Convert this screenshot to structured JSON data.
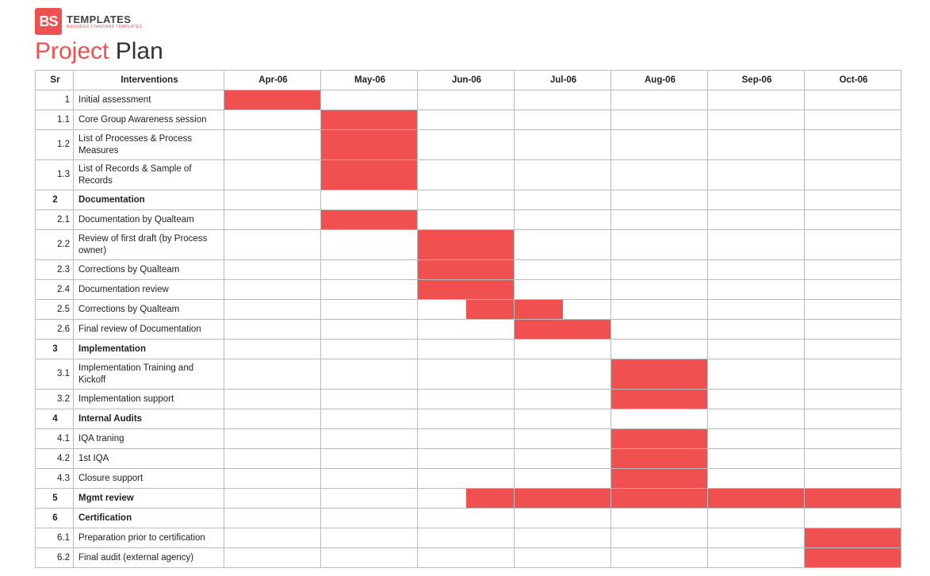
{
  "brand": {
    "logo_text": "BS",
    "label": "TEMPLATES",
    "sublabel": "BUSINESS STANDARD TEMPLATES"
  },
  "title": {
    "accent": "Project",
    "rest": " Plan"
  },
  "headers": {
    "sr": "Sr",
    "desc": "Interventions",
    "months": [
      "Apr-06",
      "May-06",
      "Jun-06",
      "Jul-06",
      "Aug-06",
      "Sep-06",
      "Oct-06"
    ]
  },
  "rows": [
    {
      "sr": "1",
      "desc": "Initial assessment",
      "tall": false,
      "sec": false,
      "bars": [
        "full",
        "",
        "",
        "",
        "",
        "",
        ""
      ]
    },
    {
      "sr": "1.1",
      "desc": "Core Group Awareness session",
      "tall": false,
      "sec": false,
      "bars": [
        "",
        "full",
        "",
        "",
        "",
        "",
        ""
      ]
    },
    {
      "sr": "1.2",
      "desc": "List of Processes & Process Measures",
      "tall": true,
      "sec": false,
      "bars": [
        "",
        "full",
        "",
        "",
        "",
        "",
        ""
      ]
    },
    {
      "sr": "1.3",
      "desc": "List of Records & Sample of Records",
      "tall": true,
      "sec": false,
      "bars": [
        "",
        "full",
        "",
        "",
        "",
        "",
        ""
      ]
    },
    {
      "sr": "2",
      "desc": "Documentation",
      "tall": false,
      "sec": true,
      "bars": [
        "",
        "",
        "",
        "",
        "",
        "",
        ""
      ]
    },
    {
      "sr": "2.1",
      "desc": "Documentation by Qualteam",
      "tall": false,
      "sec": false,
      "bars": [
        "",
        "full",
        "",
        "",
        "",
        "",
        ""
      ]
    },
    {
      "sr": "2.2",
      "desc": "Review of first draft (by Process owner)",
      "tall": true,
      "sec": false,
      "bars": [
        "",
        "",
        "full",
        "",
        "",
        "",
        ""
      ]
    },
    {
      "sr": "2.3",
      "desc": "Corrections by Qualteam",
      "tall": false,
      "sec": false,
      "bars": [
        "",
        "",
        "full",
        "",
        "",
        "",
        ""
      ]
    },
    {
      "sr": "2.4",
      "desc": "Documentation review",
      "tall": false,
      "sec": false,
      "bars": [
        "",
        "",
        "full",
        "",
        "",
        "",
        ""
      ]
    },
    {
      "sr": "2.5",
      "desc": "Corrections by Qualteam",
      "tall": false,
      "sec": false,
      "bars": [
        "",
        "",
        "right",
        "left",
        "",
        "",
        ""
      ]
    },
    {
      "sr": "2.6",
      "desc": "Final review of Documentation",
      "tall": false,
      "sec": false,
      "bars": [
        "",
        "",
        "",
        "full",
        "",
        "",
        ""
      ]
    },
    {
      "sr": "3",
      "desc": "Implementation",
      "tall": false,
      "sec": true,
      "bars": [
        "",
        "",
        "",
        "",
        "",
        "",
        ""
      ]
    },
    {
      "sr": "3.1",
      "desc": "Implementation Training and Kickoff",
      "tall": true,
      "sec": false,
      "bars": [
        "",
        "",
        "",
        "",
        "full",
        "",
        ""
      ]
    },
    {
      "sr": "3.2",
      "desc": "Implementation support",
      "tall": false,
      "sec": false,
      "bars": [
        "",
        "",
        "",
        "",
        "full",
        "",
        ""
      ]
    },
    {
      "sr": "4",
      "desc": "Internal Audits",
      "tall": false,
      "sec": true,
      "bars": [
        "",
        "",
        "",
        "",
        "",
        "",
        ""
      ]
    },
    {
      "sr": "4.1",
      "desc": "IQA traning",
      "tall": false,
      "sec": false,
      "bars": [
        "",
        "",
        "",
        "",
        "full",
        "",
        ""
      ]
    },
    {
      "sr": "4.2",
      "desc": "1st IQA",
      "tall": false,
      "sec": false,
      "bars": [
        "",
        "",
        "",
        "",
        "full",
        "",
        ""
      ]
    },
    {
      "sr": "4.3",
      "desc": "Closure support",
      "tall": false,
      "sec": false,
      "bars": [
        "",
        "",
        "",
        "",
        "full",
        "",
        ""
      ]
    },
    {
      "sr": "5",
      "desc": "Mgmt review",
      "tall": false,
      "sec": true,
      "bars": [
        "",
        "",
        "right",
        "full",
        "full",
        "full",
        "full"
      ]
    },
    {
      "sr": "6",
      "desc": "Certification",
      "tall": false,
      "sec": true,
      "bars": [
        "",
        "",
        "",
        "",
        "",
        "",
        ""
      ]
    },
    {
      "sr": "6.1",
      "desc": "Preparation prior to certification",
      "tall": false,
      "sec": false,
      "bars": [
        "",
        "",
        "",
        "",
        "",
        "",
        "full"
      ]
    },
    {
      "sr": "6.2",
      "desc": "Final audit (external agency)",
      "tall": false,
      "sec": false,
      "bars": [
        "",
        "",
        "",
        "",
        "",
        "",
        "full"
      ]
    }
  ],
  "chart_data": {
    "type": "bar",
    "title": "Project Plan",
    "categories": [
      "Apr-06",
      "May-06",
      "Jun-06",
      "Jul-06",
      "Aug-06",
      "Sep-06",
      "Oct-06"
    ],
    "series": [
      {
        "name": "Initial assessment",
        "start": "Apr-06",
        "end": "Apr-06"
      },
      {
        "name": "Core Group Awareness session",
        "start": "May-06",
        "end": "May-06"
      },
      {
        "name": "List of Processes & Process Measures",
        "start": "May-06",
        "end": "May-06"
      },
      {
        "name": "List of Records & Sample of Records",
        "start": "May-06",
        "end": "May-06"
      },
      {
        "name": "Documentation by Qualteam",
        "start": "May-06",
        "end": "May-06"
      },
      {
        "name": "Review of first draft (by Process owner)",
        "start": "Jun-06",
        "end": "Jun-06"
      },
      {
        "name": "Corrections by Qualteam",
        "start": "Jun-06",
        "end": "Jun-06"
      },
      {
        "name": "Documentation review",
        "start": "Jun-06",
        "end": "Jun-06"
      },
      {
        "name": "Corrections by Qualteam",
        "start": "mid Jun-06",
        "end": "mid Jul-06"
      },
      {
        "name": "Final review of Documentation",
        "start": "Jul-06",
        "end": "Jul-06"
      },
      {
        "name": "Implementation Training and Kickoff",
        "start": "Aug-06",
        "end": "Aug-06"
      },
      {
        "name": "Implementation support",
        "start": "Aug-06",
        "end": "Aug-06"
      },
      {
        "name": "IQA traning",
        "start": "Aug-06",
        "end": "Aug-06"
      },
      {
        "name": "1st IQA",
        "start": "Aug-06",
        "end": "Aug-06"
      },
      {
        "name": "Closure support",
        "start": "Aug-06",
        "end": "Aug-06"
      },
      {
        "name": "Mgmt review",
        "start": "mid Jun-06",
        "end": "Oct-06"
      },
      {
        "name": "Preparation prior to certification",
        "start": "Oct-06",
        "end": "Oct-06"
      },
      {
        "name": "Final audit (external agency)",
        "start": "Oct-06",
        "end": "Oct-06"
      }
    ]
  }
}
